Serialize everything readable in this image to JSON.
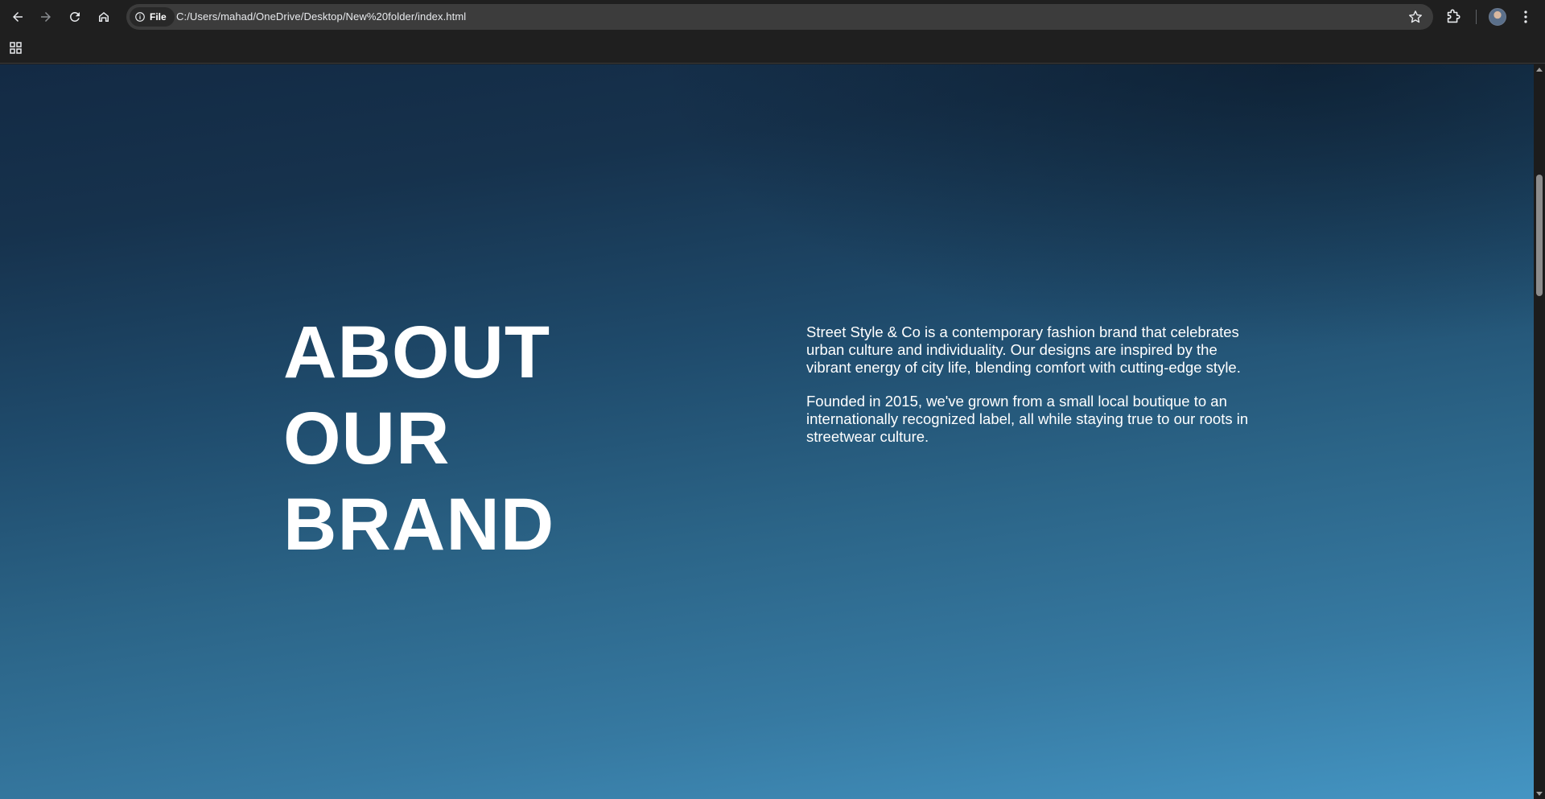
{
  "browser": {
    "address_chip": "File",
    "url": "C:/Users/mahad/OneDrive/Desktop/New%20folder/index.html",
    "icons": [
      "back-icon",
      "forward-icon",
      "reload-icon",
      "home-icon",
      "info-icon",
      "star-icon",
      "extensions-icon",
      "profile-avatar",
      "more-menu-icon",
      "apps-icon"
    ]
  },
  "page": {
    "about": {
      "title": "ABOUT\nOUR\nBRAND",
      "paragraph_1": "Street Style & Co is a contemporary fashion brand that celebrates urban culture and individuality. Our designs are inspired by the vibrant energy of city life, blending comfort with cutting-edge style.",
      "paragraph_2": "Founded in 2015, we've grown from a small local boutique to an internationally recognized label, all while staying true to our roots in streetwear culture."
    },
    "colors": {
      "background_top": "#132a44",
      "background_bottom": "#4495c3",
      "text": "#ffffff"
    }
  }
}
